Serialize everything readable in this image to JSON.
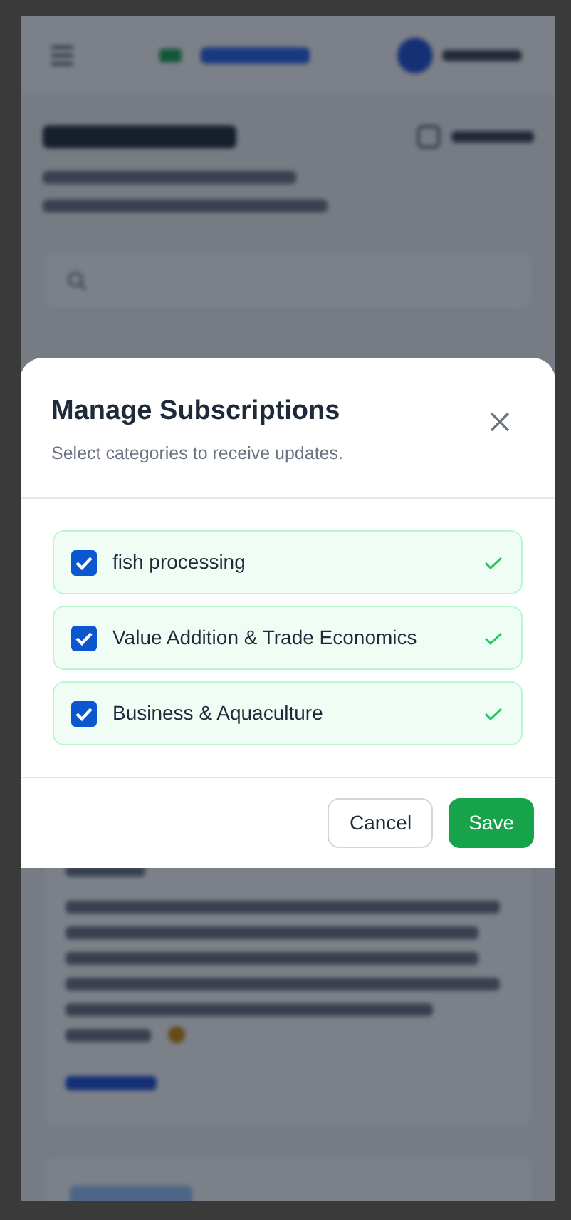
{
  "dialog": {
    "title": "Manage Subscriptions",
    "subtitle": "Select categories to receive updates.",
    "categories": [
      {
        "label": "fish processing",
        "checked": true
      },
      {
        "label": "Value Addition & Trade Economics",
        "checked": true
      },
      {
        "label": "Business & Aquaculture",
        "checked": true
      }
    ],
    "buttons": [
      {
        "label": "Cancel",
        "kind": "secondary"
      },
      {
        "label": "Save",
        "kind": "primary"
      }
    ]
  }
}
